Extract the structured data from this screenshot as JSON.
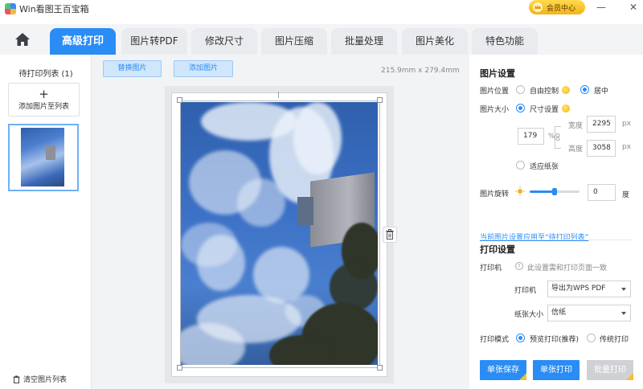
{
  "app": {
    "title": "Win看图王百宝箱"
  },
  "vip": {
    "label": "会员中心"
  },
  "tabs": [
    {
      "label": "高级打印"
    },
    {
      "label": "图片转PDF"
    },
    {
      "label": "修改尺寸"
    },
    {
      "label": "图片压缩"
    },
    {
      "label": "批量处理"
    },
    {
      "label": "图片美化"
    },
    {
      "label": "特色功能"
    }
  ],
  "left": {
    "list_title": "待打印列表 (1)",
    "add_plus": "+",
    "add_label": "添加图片至列表",
    "clear_label": "清空图片列表"
  },
  "center": {
    "replace_label": "替换图片",
    "add_label": "添加图片",
    "paper_size": "215.9mm  x  279.4mm"
  },
  "image_settings": {
    "title": "图片设置",
    "position_label": "图片位置",
    "free_label": "自由控制",
    "center_label": "居中",
    "size_label": "图片大小",
    "size_set_label": "尺寸设置",
    "percent_value": "179",
    "percent_unit": "%",
    "width_label": "宽度",
    "width_value": "2295",
    "height_label": "高度",
    "height_value": "3058",
    "px_unit": "px",
    "fit_label": "适应纸张",
    "rotate_label": "图片旋转",
    "rotate_value": "0",
    "rotate_unit": "度",
    "slider_position": 0.5
  },
  "apply_link": "当前图片设置应用至“待打印列表”",
  "print_settings": {
    "title": "打印设置",
    "printer_section_label": "打印机",
    "printer_note": "此设置需和打印页面一致",
    "printer_label": "打印机",
    "printer_value": "导出为WPS PDF",
    "paper_label": "纸张大小",
    "paper_value": "信纸",
    "mode_label": "打印模式",
    "preview_label": "预览打印(推荐)",
    "traditional_label": "传统打印"
  },
  "actions": {
    "save_single": "单张保存",
    "print_single": "单张打印",
    "print_batch": "批量打印"
  },
  "colors": {
    "accent": "#2a8cf5",
    "vip": "#f5c02b"
  }
}
